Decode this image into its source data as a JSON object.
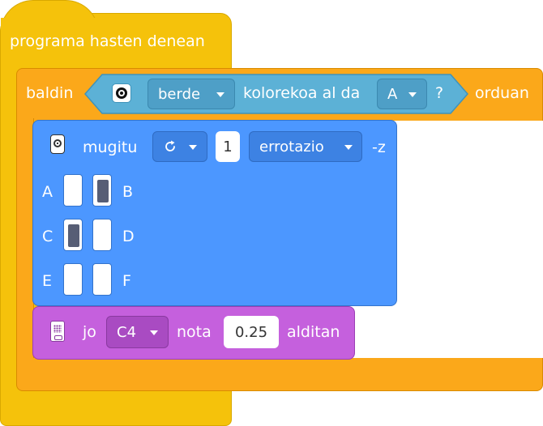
{
  "event_block": {
    "label": "programa hasten denean"
  },
  "if_block": {
    "if_label": "baldin",
    "then_label": "orduan",
    "sensor_icon": "color-sensor-icon",
    "color_value": "berde",
    "middle_label": "kolorekoa al da",
    "port_value": "A",
    "question_mark": "?"
  },
  "move_block": {
    "icon": "motor-icon",
    "label": "mugitu",
    "direction_icon": "clockwise-icon",
    "amount": "1",
    "unit_value": "errotazio",
    "suffix": "-z",
    "ports": [
      {
        "label": "A",
        "selected": false
      },
      {
        "label": "B",
        "selected": true
      },
      {
        "label": "C",
        "selected": true
      },
      {
        "label": "D",
        "selected": false
      },
      {
        "label": "E",
        "selected": false
      },
      {
        "label": "F",
        "selected": false
      }
    ]
  },
  "sound_block": {
    "icon": "hub-speaker-icon",
    "play_label": "jo",
    "note_value": "C4",
    "note_label": "nota",
    "duration": "0.25",
    "duration_label": "alditan"
  },
  "colors": {
    "event": "#f5c20b",
    "control": "#fba81a",
    "motion": "#4c97ff",
    "sound": "#c560dd",
    "sensor": "#5cb1d6"
  }
}
